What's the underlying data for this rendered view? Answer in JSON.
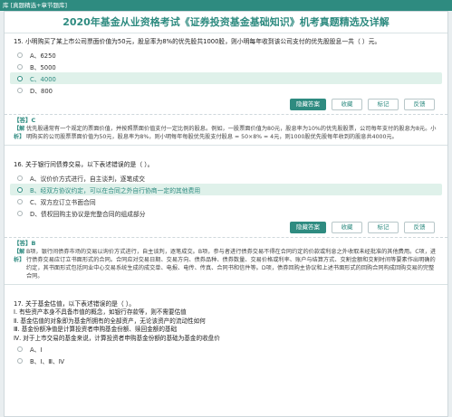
{
  "topbar": {
    "label": "库 [真题精选+章节题库]"
  },
  "header": {
    "title": "2020年基金从业资格考试《证券投资基金基础知识》机考真题精选及详解"
  },
  "buttons": {
    "hide": "隐藏答案",
    "fav": "收藏",
    "mark": "标记",
    "feedback": "反馈"
  },
  "q15": {
    "text": "15. 小明购买了某上市公司票面价值为50元，股息率为8%的优先股共1000股，则小明每年收到该公司支付的优先股股息一共（    ）元。",
    "options": [
      "A、6250",
      "B、5000",
      "C、4000",
      "D、800"
    ],
    "answer": "【答】C",
    "analysis_tag": "【解析】",
    "analysis": "优先股通常有一个规定的票面价值，并按照票面价值支付一定比例的股息。例如，一股票面价值为80元，股息率为10%的优先股股票，公司每年支付的股息为8元。小明购买的公司股票票面价值为50元，股息率为8%，则小明每年每股优先股支付股息 = 50×8% = 4元，则1000股优先股每年收到的股息共4000元。"
  },
  "q16": {
    "text": "16. 关于银行间债券交易，以下表述错误的是（    ）。",
    "options": [
      "A、议价价方式进行，自主谈判，逐笔成交",
      "B、经双方协议约定，可以在合同之外自行协商一定的其他费用",
      "C、双方应订立书面合同",
      "D、债权回购主协议是完整合同的组成部分"
    ],
    "answer": "【答】B",
    "analysis_tag": "【解析】",
    "analysis": "B项，银行间债券市场的交易以询价方式进行，自主谈判，逐笔成交。B项，参与者进行债券交易不得在合同约定的价款或利息之外收取未经批准的其他费用。C项，进行债券交易应订立书面形式的合同。合同应对交易日期、交易方向、债券品种、债券数量、交易价格或利率、账户与结算方式、交割金额和交割时间等要素作出明确的约定，其书面形式包括同业中心交易系统生成的成交单、电报、电传、传真、合同书和信件等。D项，债券回购主协议和上述书面形式的回购合同构成回购交易的完整合同。"
  },
  "q17": {
    "text": "17. 关于基金估值，以下表述错误的是（    ）。",
    "statements": [
      "Ⅰ. 有些资产本身不具备市值的概念，如银行存款等，则不需要估值",
      "Ⅱ. 基金估值的对象即为基金所拥有的全部资产，无论该资产的流动性如何",
      "Ⅲ. 基金份额净值是计算投资者申购基金份额、赎回金额的基础",
      "Ⅳ. 对于上市交易的基金来说，计算投资者申购基金份额的基础为基金的收盘价"
    ],
    "options": [
      "A、Ⅰ",
      "B、Ⅰ、Ⅲ、Ⅳ"
    ]
  }
}
